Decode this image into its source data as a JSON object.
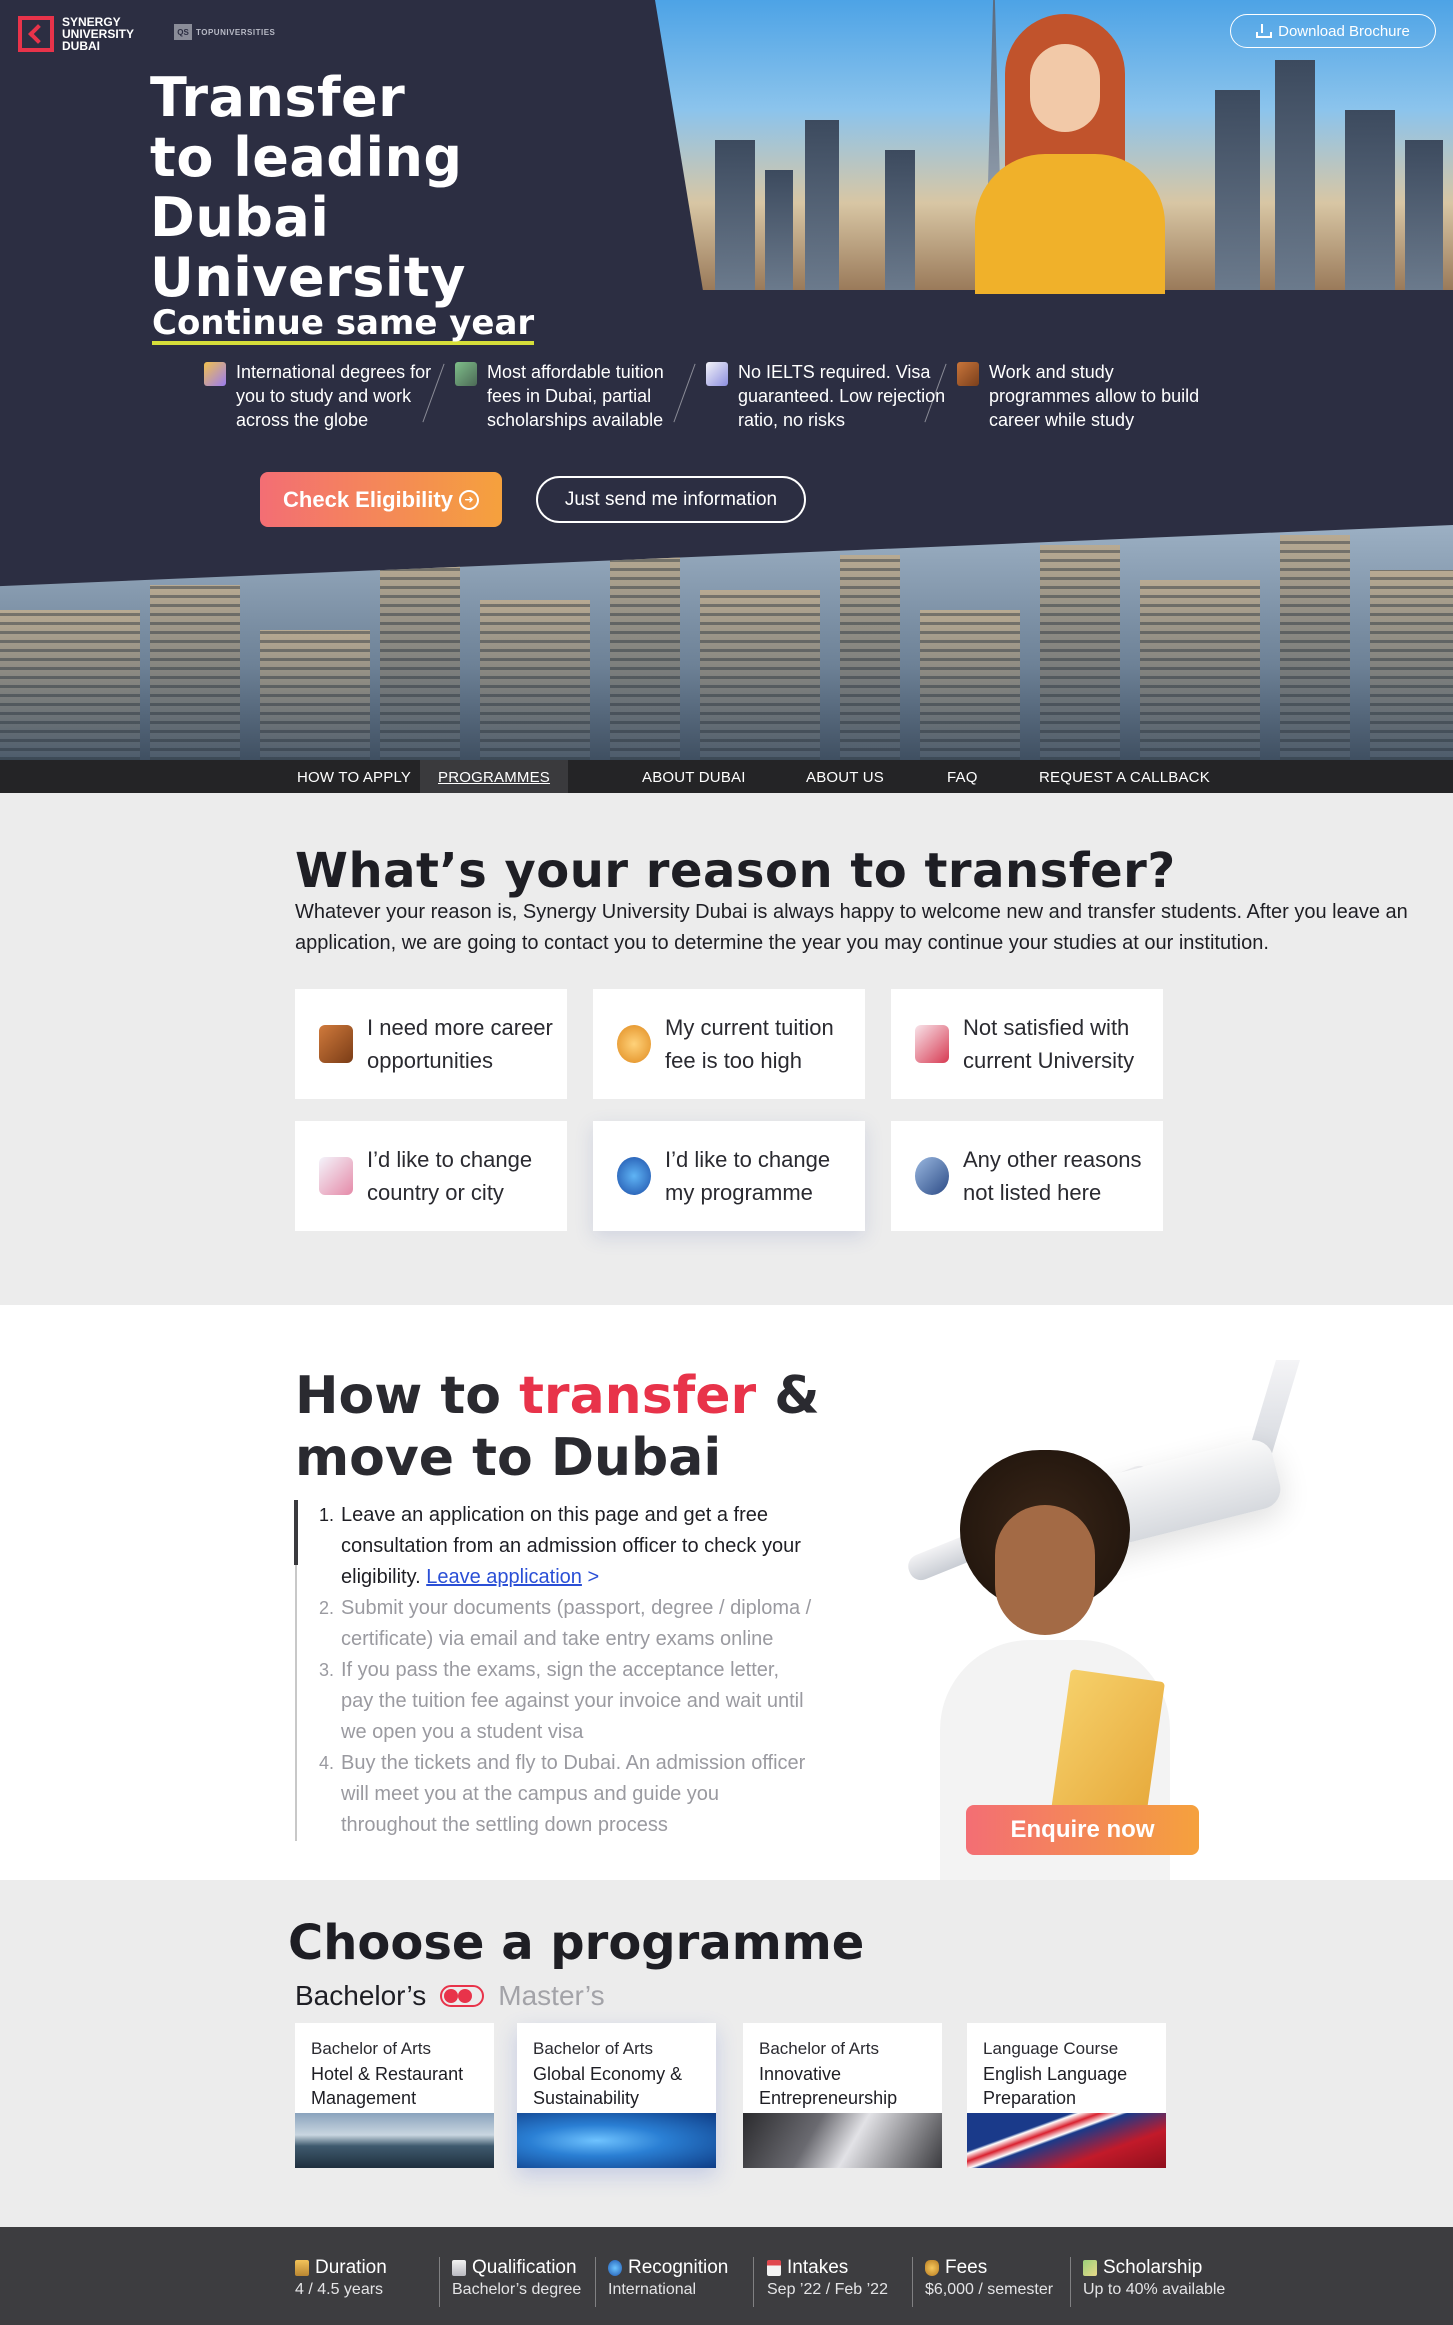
{
  "brand": {
    "name": "SYNERGY\nUNIVERSITY\nDUBAI",
    "partner_badge": "QS",
    "partner_name": "TOPUNIVERSITIES"
  },
  "header": {
    "download_label": "Download Brochure"
  },
  "hero": {
    "title": "Transfer\nto leading\nDubai\nUniversity",
    "subtitle": "Continue same year",
    "features": [
      {
        "icon": "graduation-book-icon",
        "text": "International degrees for you to study and work across the globe"
      },
      {
        "icon": "graduation-cap-icon",
        "text": "Most affordable tuition fees in Dubai, partial scholarships available"
      },
      {
        "icon": "document-icon",
        "text": "No IELTS required. Visa guaranteed. Low rejection ratio, no risks"
      },
      {
        "icon": "briefcase-icon",
        "text": "Work and study programmes allow to build career while study"
      }
    ],
    "cta_primary": "Check Eligibility",
    "cta_secondary": "Just send me information"
  },
  "nav": {
    "items": [
      "HOW TO APPLY",
      "PROGRAMMES",
      "ABOUT DUBAI",
      "ABOUT US",
      "FAQ",
      "REQUEST A CALLBACK"
    ],
    "active": "PROGRAMMES"
  },
  "reasons": {
    "title": "What’s your reason to transfer?",
    "intro": "Whatever your reason is, Synergy University Dubai is always happy to welcome new and transfer students. After you leave an application, we are going to contact you to determine the year you may continue your studies at our institution.",
    "cards": [
      {
        "icon": "briefcase-icon",
        "label": "I need more career\nopportunities"
      },
      {
        "icon": "coin-icon",
        "label": "My current tuition\nfee is too high"
      },
      {
        "icon": "fail-stamp-icon",
        "label": "Not satisfied with\ncurrent University"
      },
      {
        "icon": "airplane-icon",
        "label": "I’d like to change\ncountry or city"
      },
      {
        "icon": "swap-arrows-icon",
        "label": "I’d like to change\nmy programme"
      },
      {
        "icon": "magnifier-icon",
        "label": "Any other reasons\nnot listed here"
      }
    ]
  },
  "howto": {
    "title_part1": "How to ",
    "title_accent": "transfer",
    "title_part2": " &\nmove to Dubai",
    "steps": [
      {
        "num": "1.",
        "text": "Leave an application on this page and get a free consultation from an admission officer to check your eligibility. ",
        "link": "Leave application",
        "link_suffix": " >"
      },
      {
        "num": "2.",
        "text": "Submit your documents (passport, degree / diploma / certificate) via email and take entry exams online"
      },
      {
        "num": "3.",
        "text": "If you pass the exams, sign the acceptance letter, pay the tuition fee against your invoice and wait until we open you a student visa"
      },
      {
        "num": "4.",
        "text": "Buy the tickets and fly to Dubai. An admission officer will meet you at the campus and guide you throughout the settling down process"
      }
    ],
    "cta": "Enquire now"
  },
  "programmes": {
    "title": "Choose a programme",
    "toggle_on": "Bachelor’s",
    "toggle_off": "Master’s",
    "cards": [
      {
        "degree": "Bachelor of Arts",
        "name": "Hotel & Restaurant\nManagement",
        "thumb": "harbor-photo"
      },
      {
        "degree": "Bachelor of Arts",
        "name": "Global Economy &\nSustainability",
        "thumb": "world-map-photo"
      },
      {
        "degree": "Bachelor of Arts",
        "name": "Innovative\nEntrepreneurship",
        "thumb": "meeting-photo"
      },
      {
        "degree": "Language Course",
        "name": "English Language\nPreparation",
        "thumb": "uk-flag-photo"
      }
    ]
  },
  "stats": [
    {
      "icon": "hourglass-icon",
      "label": "Duration",
      "value": "4 / 4.5 years"
    },
    {
      "icon": "certificate-icon",
      "label": "Qualification",
      "value": "Bachelor’s degree"
    },
    {
      "icon": "globe-icon",
      "label": "Recognition",
      "value": "International"
    },
    {
      "icon": "calendar-icon",
      "label": "Intakes",
      "value": "Sep ’22 / Feb ’22"
    },
    {
      "icon": "money-bag-icon",
      "label": "Fees",
      "value": "$6,000 / semester"
    },
    {
      "icon": "cash-icon",
      "label": "Scholarship",
      "value": "Up to 40% available"
    }
  ],
  "colors": {
    "accent": "#e8334a",
    "hero_bg": "#2c2e42",
    "cta_from": "#f36e74",
    "cta_to": "#f5a13d",
    "underline": "#d6de3a"
  }
}
